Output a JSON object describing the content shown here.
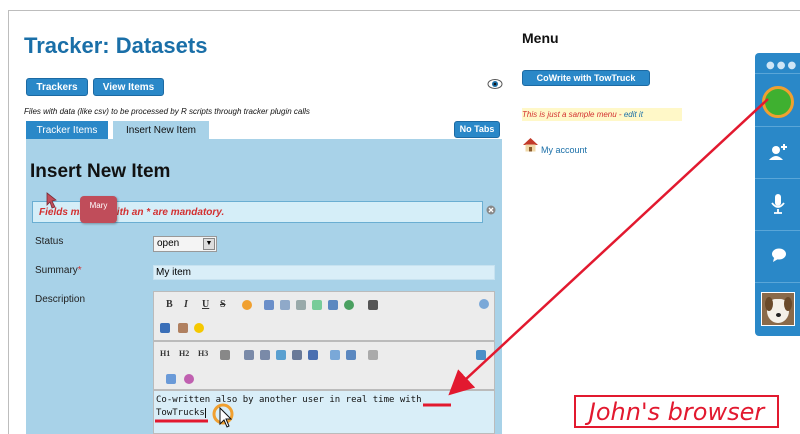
{
  "page": {
    "title": "Tracker: Datasets",
    "buttons": {
      "trackers": "Trackers",
      "view_items": "View Items",
      "no_tabs": "No Tabs"
    },
    "description": "Files with data (like csv) to be processed by R scripts through tracker plugin calls",
    "tabs": [
      {
        "label": "Tracker Items",
        "active": false
      },
      {
        "label": "Insert New Item",
        "active": true
      }
    ]
  },
  "form": {
    "heading": "Insert New Item",
    "mandatory_note": "Fields marked with an * are mandatory.",
    "collaborator_tag": "Mary",
    "fields": {
      "status": {
        "label": "Status",
        "value": "open"
      },
      "summary": {
        "label": "Summary",
        "required_marker": "*",
        "value": "My item"
      },
      "description": {
        "label": "Description"
      }
    },
    "toolbar": {
      "bold": "B",
      "italic": "I",
      "underline": "U",
      "strike": "S",
      "h1": "H1",
      "h2": "H2",
      "h3": "H3"
    },
    "editor_line1_a": "Co-written also by another user in real time ",
    "editor_line1_b": "with",
    "editor_line2": "TowTrucks"
  },
  "menu": {
    "title": "Menu",
    "cowrite_button": "CoWrite with TowTruck",
    "sample_note": "This is just a sample menu - ",
    "edit_link": "edit it",
    "account_link": "My account"
  },
  "towtruck_sidebar": {
    "items": [
      "more-icon",
      "self-avatar",
      "add-user-icon",
      "microphone-icon",
      "chat-icon",
      "peer-avatar"
    ]
  },
  "annotation": {
    "label": "John's browser",
    "color": "#e2192f"
  },
  "colors": {
    "accent": "#2a88c8",
    "panel": "#a8d2e8",
    "title": "#1a6fa8",
    "error": "#d33030"
  }
}
